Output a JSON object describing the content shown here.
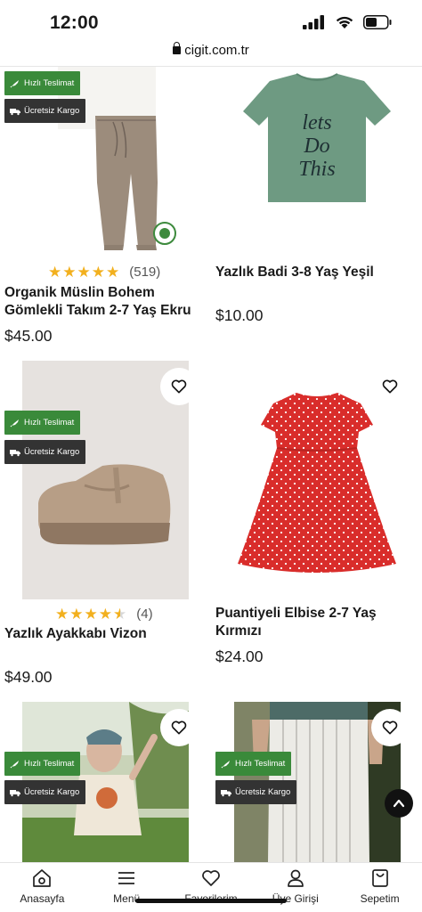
{
  "status_bar": {
    "time": "12:00"
  },
  "browser": {
    "url": "cigit.com.tr"
  },
  "badges": {
    "fast_delivery": "Hızlı Teslimat",
    "free_shipping": "Ücretsiz Kargo"
  },
  "products": [
    {
      "title_line1": "Organik Müslin Bohem",
      "title_line2": "Gömlekli Takım 2-7 Yaş Ekru",
      "price": "$45.00",
      "rating_count": "(519)",
      "rating": 5
    },
    {
      "title_line1": "Yazlık Badi 3-8 Yaş Yeşil",
      "title_line2": "",
      "price": "$10.00"
    },
    {
      "title_line1": "Yazlık Ayakkabı Vizon",
      "title_line2": "",
      "price": "$49.00",
      "rating_count": "(4)",
      "rating": 4.5
    },
    {
      "title_line1": "Puantiyeli Elbise 2-7 Yaş",
      "title_line2": "Kırmızı",
      "price": "$24.00"
    },
    {
      "title_line1": "",
      "title_line2": "",
      "price": ""
    },
    {
      "title_line1": "",
      "title_line2": "",
      "price": ""
    }
  ],
  "bottom_nav": {
    "home": "Anasayfa",
    "menu": "Menü",
    "favorites": "Favorilerim",
    "login": "Üye Girişi",
    "cart": "Sepetim"
  },
  "colors": {
    "badge_green": "#3a8a3a",
    "badge_dark": "#333333",
    "star": "#f2b01e"
  }
}
